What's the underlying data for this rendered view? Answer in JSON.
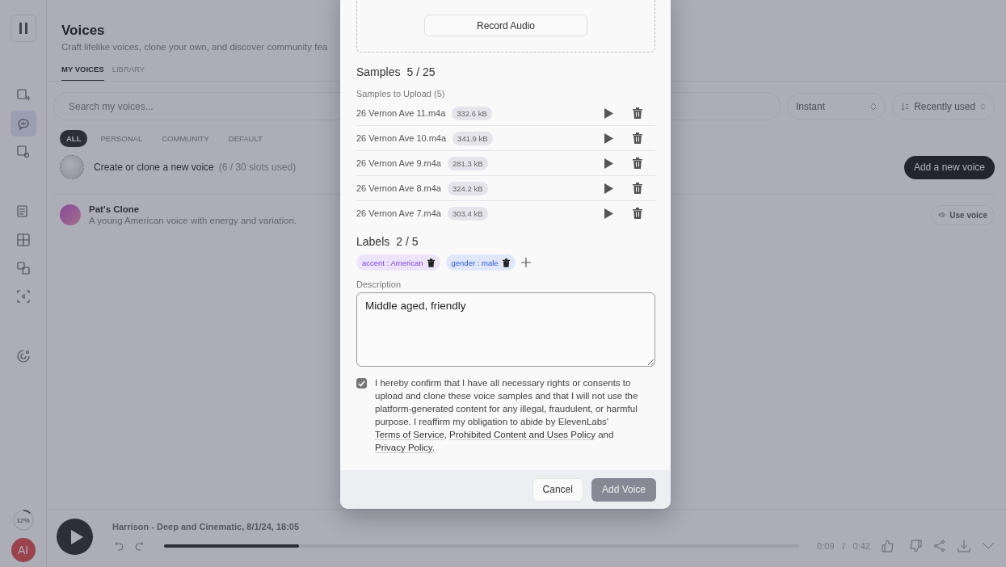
{
  "sidebar": {
    "items": [
      {
        "kind": "text-speech",
        "selected": false
      },
      {
        "kind": "voices",
        "selected": true
      },
      {
        "kind": "voice-changer",
        "selected": false
      },
      {
        "kind": "projects",
        "selected": false
      },
      {
        "kind": "dubbing",
        "selected": false
      },
      {
        "kind": "translate",
        "selected": false
      },
      {
        "kind": "isolator",
        "selected": false
      },
      {
        "kind": "sound",
        "selected": false
      }
    ],
    "usage": {
      "label": "12%",
      "level": 0.12
    },
    "avatar": "AI"
  },
  "header": {
    "title": "Voices",
    "subtitle": "Craft lifelike voices, clone your own, and discover community fea"
  },
  "tabs": [
    {
      "label": "MY VOICES",
      "selected": true
    },
    {
      "label": "LIBRARY",
      "selected": false
    }
  ],
  "search": {
    "placeholder": "Search my voices..."
  },
  "selects": [
    {
      "kind": "plain",
      "value": "Instant"
    },
    {
      "kind": "sort",
      "value": "Recently used"
    }
  ],
  "filters": [
    {
      "label": "ALL",
      "selected": true
    },
    {
      "label": "PERSONAL",
      "selected": false
    },
    {
      "label": "COMMUNITY",
      "selected": false
    },
    {
      "label": "DEFAULT",
      "selected": false
    }
  ],
  "create": {
    "label": "Create or clone a new voice",
    "slots": "(6 / 30 slots used)",
    "button": "Add a new voice"
  },
  "voices": [
    {
      "name": "Pat's Clone",
      "description": "A young American voice with energy and variation.",
      "button": "Use voice"
    }
  ],
  "player": {
    "title": "Harrison - Deep and Cinematic, 8/1/24, 18:05",
    "level": 0.21,
    "current": "0:09",
    "separator": "/",
    "total": "0:42"
  },
  "modal": {
    "record_button": "Record Audio",
    "samples_title": "Samples",
    "samples_count": "5 / 25",
    "upload_title": "Samples to Upload (5)",
    "samples": [
      {
        "name": "26 Vernon Ave 11.m4a",
        "size": "332.6 kB"
      },
      {
        "name": "26 Vernon Ave 10.m4a",
        "size": "341.9 kB"
      },
      {
        "name": "26 Vernon Ave 9.m4a",
        "size": "281.3 kB"
      },
      {
        "name": "26 Vernon Ave 8.m4a",
        "size": "324.2 kB"
      },
      {
        "name": "26 Vernon Ave 7.m4a",
        "size": "303.4 kB"
      }
    ],
    "labels_title": "Labels",
    "labels_count": "2 / 5",
    "labels": [
      {
        "text": "accent : American",
        "color": "#ede4fb"
      },
      {
        "text": "gender : male",
        "color": "#e1e7fb"
      }
    ],
    "description_label": "Description",
    "description": "Middle aged, friendly",
    "consent": {
      "checked": true,
      "parts": [
        {
          "kind": "text",
          "text": "I hereby confirm that I have all necessary rights or consents to upload and clone these voice samples and that I will not use the platform-generated content for any illegal, fraudulent, or harmful purpose. I reaffirm my obligation to abide by ElevenLabs' "
        },
        {
          "kind": "link",
          "text": "Terms of Service"
        },
        {
          "kind": "text",
          "text": ", "
        },
        {
          "kind": "link",
          "text": "Prohibited Content and Uses Policy"
        },
        {
          "kind": "text",
          "text": " and "
        },
        {
          "kind": "link",
          "text": "Privacy Policy."
        }
      ]
    },
    "cancel": "Cancel",
    "submit": "Add Voice"
  }
}
